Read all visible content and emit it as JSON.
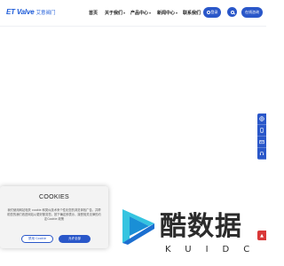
{
  "header": {
    "logo_en": "ET Valve",
    "logo_cn": "艾意阀门",
    "nav": [
      {
        "label": "首页",
        "has_dropdown": false
      },
      {
        "label": "关于我们",
        "has_dropdown": true
      },
      {
        "label": "产品中心",
        "has_dropdown": true
      },
      {
        "label": "新闻中心",
        "has_dropdown": true
      },
      {
        "label": "联系我们",
        "has_dropdown": false
      }
    ],
    "login_label": "登录",
    "contact_label": "在线咨询"
  },
  "sidebar": {
    "items": [
      {
        "icon": "globe-icon"
      },
      {
        "icon": "phone-icon"
      },
      {
        "icon": "mail-icon"
      },
      {
        "icon": "headset-icon"
      }
    ],
    "back_top_icon": "arrow-up-icon"
  },
  "cookie": {
    "title": "COOKIES",
    "text": "我们使用网站相关 cookie 和类似技术来个性化您的浏览体验广告。并帮助您的我们改进网站以更好服务您。按下确定即表示，接受相关法律的约定Cookie 政策",
    "reject_label": "禁用 Cookie",
    "accept_label": "允许全部"
  },
  "watermark": {
    "cn": "酷数据",
    "en": "KUIDC"
  },
  "colors": {
    "brand": "#2a57c9",
    "accent_red": "#d93838",
    "watermark_cyan": "#35c4e0"
  }
}
